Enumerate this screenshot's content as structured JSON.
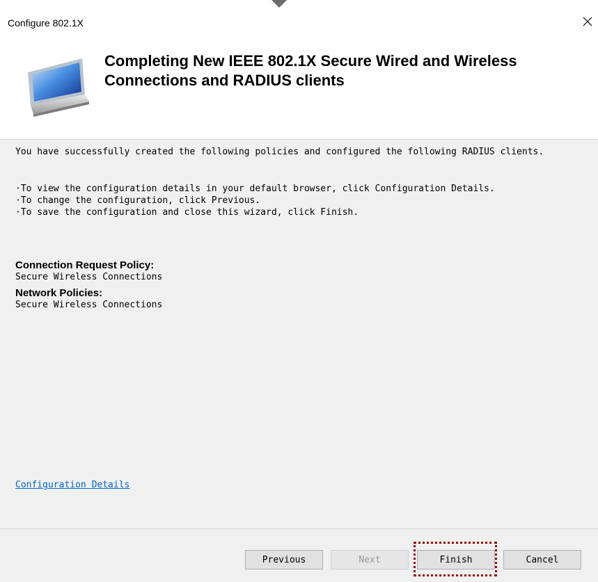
{
  "window": {
    "title": "Configure 802.1X",
    "close_glyph": "✕"
  },
  "header": {
    "title": "Completing New IEEE 802.1X Secure Wired and Wireless Connections and RADIUS clients",
    "icon": "monitor-icon"
  },
  "content": {
    "intro": "You have successfully created the following policies and configured the following RADIUS clients.",
    "bullets": [
      "To view the configuration details in your default browser, click Configuration Details.",
      "To change the configuration, click Previous.",
      "To save the configuration and close this wizard, click Finish."
    ],
    "connection_request_heading": "Connection Request Policy:",
    "connection_request_value": "Secure Wireless Connections",
    "network_policies_heading": "Network Policies:",
    "network_policies_value": "Secure Wireless Connections",
    "config_link": "Configuration Details"
  },
  "buttons": {
    "previous": "Previous",
    "next": "Next",
    "finish": "Finish",
    "cancel": "Cancel"
  },
  "colors": {
    "link": "#0066cc",
    "highlight": "#a00000",
    "background": "#f0f0f0"
  }
}
